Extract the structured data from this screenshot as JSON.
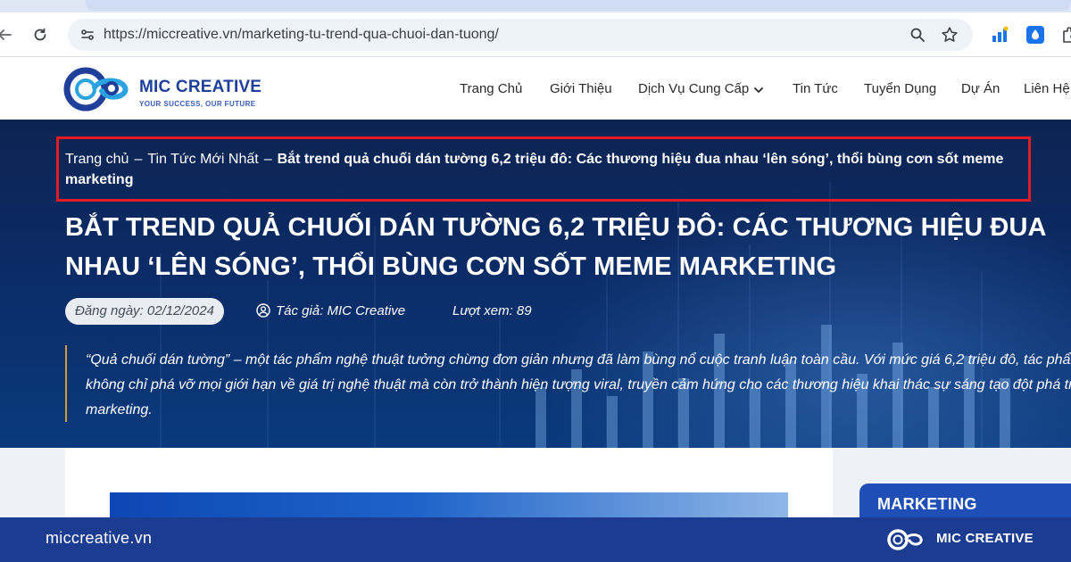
{
  "browser": {
    "url": "https://miccreative.vn/marketing-tu-trend-qua-chuoi-dan-tuong/",
    "icons": [
      "back-arrow-icon",
      "reload-icon",
      "site-info-icon",
      "zoom-icon",
      "bookmark-star-icon",
      "analytics-extension-icon",
      "droplet-extension-icon",
      "puzzle-extension-icon"
    ]
  },
  "site": {
    "brand": "MIC CREATIVE",
    "tagline": "YOUR SUCCESS, OUR FUTURE",
    "menu": [
      {
        "label": "Trang Chủ"
      },
      {
        "label": "Giới Thiệu"
      },
      {
        "label": "Dịch Vụ Cung Cấp"
      },
      {
        "label": "Tin Tức"
      },
      {
        "label": "Tuyển Dụng"
      },
      {
        "label": "Dự Án"
      },
      {
        "label": "Liên Hệ"
      }
    ]
  },
  "hero": {
    "breadcrumb": {
      "home": "Trang chủ",
      "separator": "–",
      "category": "Tin Tức Mới Nhất",
      "current": "Bắt trend quả chuối dán tường 6,2 triệu đô: Các thương hiệu đua nhau ‘lên sóng’, thổi bùng cơn sốt meme marketing"
    },
    "title": "BẮT TREND QUẢ CHUỐI DÁN TƯỜNG 6,2 TRIỆU ĐÔ: CÁC THƯƠNG HIỆU ĐUA NHAU ‘LÊN SÓNG’, THỔI BÙNG CƠN SỐT MEME MARKETING",
    "date": "Đăng ngày: 02/12/2024",
    "author": "Tác giả: MIC Creative",
    "views": "Lượt xem: 89",
    "excerpt": "“Quả chuối dán tường” – một tác phẩm nghệ thuật tưởng chừng đơn giản nhưng đã làm bùng nổ cuộc tranh luận toàn cầu. Với mức giá 6,2 triệu đô, tác phẩm không chỉ phá vỡ mọi giới hạn về giá trị nghệ thuật mà còn trở thành hiện tượng viral, truyền cảm hứng cho các thương hiệu khai thác sự sáng tạo đột phá trong marketing."
  },
  "sidebar": {
    "category_title": "MARKETING"
  },
  "footer_bar": {
    "site_url": "miccreative.vn",
    "brand": "MIC CREATIVE"
  },
  "colors": {
    "brand_blue": "#1b3c91",
    "highlight_red": "#e21c24",
    "quote_accent": "#d49b2b"
  }
}
